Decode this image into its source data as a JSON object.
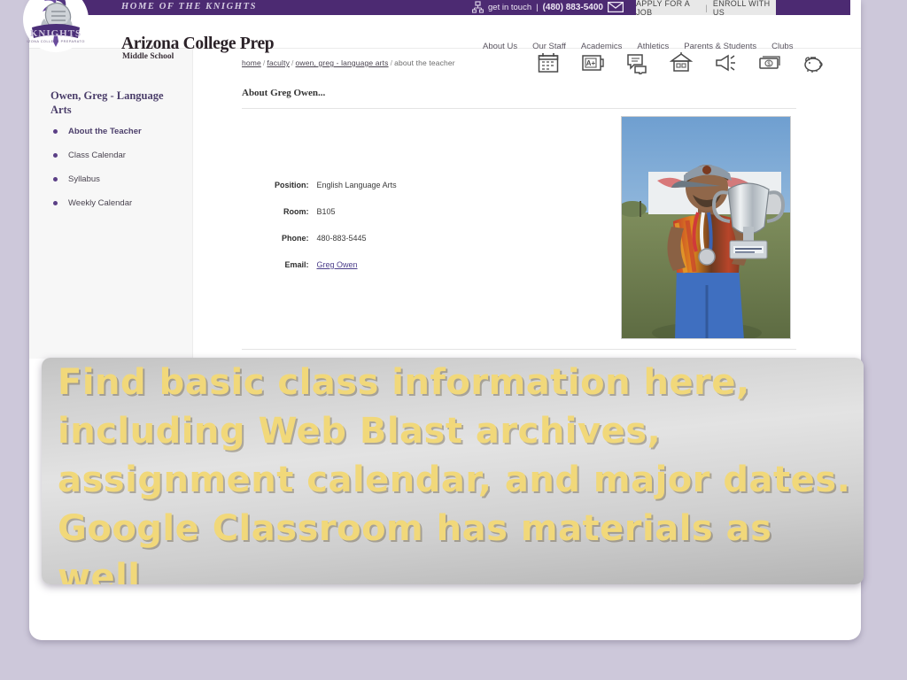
{
  "utility_bar": {
    "tagline": "HOME OF THE KNIGHTS",
    "get_in_touch_label": "get in touch",
    "divider": "|",
    "phone": "(480) 883-5400",
    "mail_icon": "envelope-icon",
    "location_icon": "map-pin-icon",
    "apply_label": "APPLY FOR A JOB",
    "apply_separator": "|",
    "enroll_label": "ENROLL WITH US"
  },
  "masthead": {
    "logo_icon": "knights-helmet-logo",
    "school_name": "Arizona College Prep",
    "school_sub": "Middle School",
    "nav": [
      {
        "label": "About Us"
      },
      {
        "label": "Our Staff"
      },
      {
        "label": "Academics"
      },
      {
        "label": "Athletics"
      },
      {
        "label": "Parents & Students"
      },
      {
        "label": "Clubs"
      }
    ]
  },
  "sidebar": {
    "title": "Owen, Greg - Language Arts",
    "items": [
      {
        "label": "About the Teacher",
        "active": true
      },
      {
        "label": "Class Calendar",
        "active": false
      },
      {
        "label": "Syllabus",
        "active": false
      },
      {
        "label": "Weekly Calendar",
        "active": false
      }
    ]
  },
  "content": {
    "breadcrumb": [
      {
        "label": "home",
        "link": true
      },
      {
        "label": "faculty",
        "link": true
      },
      {
        "label": "owen, greg - language arts",
        "link": true
      },
      {
        "label": "about the teacher",
        "link": false
      }
    ],
    "breadcrumb_separator": "/",
    "page_title": "About Greg Owen...",
    "quick_icons": [
      {
        "name": "calendar-icon"
      },
      {
        "name": "gradebook-icon"
      },
      {
        "name": "chat-bubbles-icon"
      },
      {
        "name": "school-house-icon"
      },
      {
        "name": "megaphone-icon"
      },
      {
        "name": "money-icon"
      },
      {
        "name": "piggy-bank-icon"
      }
    ],
    "details": [
      {
        "label": "Position:",
        "value": "English Language Arts",
        "is_link": false
      },
      {
        "label": "Room:",
        "value": "B105",
        "is_link": false
      },
      {
        "label": "Phone:",
        "value": "480-883-5445",
        "is_link": false
      },
      {
        "label": "Email:",
        "value": "Greg Owen",
        "is_link": true
      }
    ],
    "photo_alt": "teacher-holding-trophy-photo"
  },
  "caption": {
    "text": "Find basic class information here, including Web Blast archives, assignment calendar, and major dates. Google Classroom has materials as well"
  },
  "colors": {
    "purple": "#4c2a72",
    "sidebar_link": "#4c3f6b",
    "caption_gold": "#f1d87a",
    "page_background": "#cdc8da"
  }
}
